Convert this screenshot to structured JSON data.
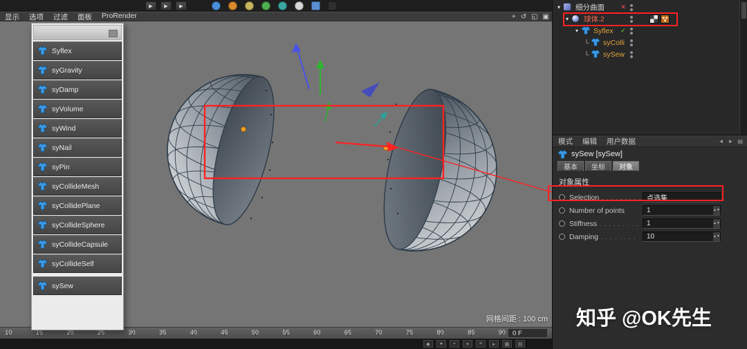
{
  "window": {
    "watermark": "知乎 @OK先生"
  },
  "top_toolbar": {
    "play_buttons": [
      "▶",
      "▶",
      "▶"
    ],
    "tool_icons": [
      {
        "name": "move-tool-icon",
        "color": "#4a90d9",
        "shape": "circle"
      },
      {
        "name": "rotate-tool-icon",
        "color": "#d98a2b",
        "shape": "circle"
      },
      {
        "name": "scale-tool-icon",
        "color": "#c8b560",
        "shape": "circle"
      },
      {
        "name": "axis-tool-icon",
        "color": "#4fae4f",
        "shape": "circle"
      },
      {
        "name": "coord-tool-icon",
        "color": "#3aa8a0",
        "shape": "circle"
      },
      {
        "name": "pen-tool-icon",
        "color": "#d8d8d8",
        "shape": "circle"
      },
      {
        "name": "grid-tool-icon",
        "color": "#5a8fd4",
        "shape": "square"
      },
      {
        "name": "render-tool-icon",
        "color": "#2f2f2f",
        "shape": "square"
      }
    ]
  },
  "viewport_menu": {
    "items": [
      "显示",
      "选项",
      "过滤",
      "面板",
      "ProRender"
    ],
    "view_icons": [
      {
        "name": "pan-view-icon",
        "glyph": "+"
      },
      {
        "name": "rotate-view-icon",
        "glyph": "↺"
      },
      {
        "name": "zoom-view-icon",
        "glyph": "◱"
      },
      {
        "name": "maximize-view-icon",
        "glyph": "▣"
      }
    ]
  },
  "tag_menu": {
    "items": [
      "Syflex",
      "syGravity",
      "syDamp",
      "syVolume",
      "syWind",
      "syNail",
      "syPin",
      "syCollideMesh",
      "syCollidePlane",
      "syCollideSphere",
      "syCollideCapsule",
      "syCollideSelf",
      "sySew"
    ]
  },
  "viewport": {
    "grid_label": "网格间距 : 100 cm"
  },
  "object_manager": {
    "rows": [
      {
        "label": "细分曲面",
        "label_color": "#d6d6d6",
        "depth": 0,
        "expander": true,
        "icon": "subdiv",
        "status_icon": "✕",
        "status_color": "#ff4d4d"
      },
      {
        "label": "球体.2",
        "label_color": "#ff6a52",
        "depth": 1,
        "expander": true,
        "icon": "sphere",
        "tags": true
      },
      {
        "label": "Syflex",
        "label_color": "#e3a33c",
        "depth": 2,
        "expander": true,
        "icon": "shirt",
        "status_icon": "✓",
        "status_color": "#74d63c"
      },
      {
        "label": "syColli",
        "label_color": "#e3a33c",
        "depth": 3,
        "expander": false,
        "icon": "shirt"
      },
      {
        "label": "sySew",
        "label_color": "#e3a33c",
        "depth": 3,
        "expander": false,
        "icon": "shirt"
      }
    ]
  },
  "attributes": {
    "menu_items": [
      "模式",
      "编辑",
      "用户数据"
    ],
    "menu_icons": [
      {
        "name": "back-icon",
        "glyph": "◄"
      },
      {
        "name": "forward-icon",
        "glyph": "►"
      },
      {
        "name": "panel-menu-icon",
        "glyph": "▤"
      }
    ],
    "object_title": "sySew [sySew]",
    "tabs": [
      {
        "label": "基本",
        "active": false
      },
      {
        "label": "坐标",
        "active": false
      },
      {
        "label": "对象",
        "active": true
      }
    ],
    "section_title": "对象属性",
    "rows": [
      {
        "label": "Selection",
        "leader": ". . . . . . . . .",
        "value": "点选集",
        "spinner": false
      },
      {
        "label": "Number of points",
        "leader": "",
        "value": "1",
        "spinner": true
      },
      {
        "label": "Stiffness",
        "leader": ". . . . . . . . .",
        "value": "1",
        "spinner": true
      },
      {
        "label": "Damping",
        "leader": ". . . . . . . .",
        "value": "10",
        "spinner": true
      }
    ]
  },
  "timeline": {
    "ticks": [
      "10",
      "15",
      "20",
      "25",
      "30",
      "35",
      "40",
      "45",
      "50",
      "55",
      "60",
      "65",
      "70",
      "75",
      "80",
      "85",
      "90"
    ],
    "frame_field": "0 F"
  },
  "bottom_toolbar": {
    "icons": [
      {
        "name": "timeline-key-icon",
        "glyph": "◆"
      },
      {
        "name": "timeline-record-icon",
        "glyph": "●"
      },
      {
        "name": "timeline-keyframe-icon",
        "glyph": "▪"
      },
      {
        "name": "timeline-marker-icon",
        "glyph": "▾"
      },
      {
        "name": "timeline-track-icon",
        "glyph": "≡"
      },
      {
        "name": "timeline-options-icon",
        "glyph": "▸"
      },
      {
        "name": "snap-icon",
        "glyph": "▦"
      },
      {
        "name": "grid-toggle-icon",
        "glyph": "▤"
      }
    ]
  },
  "annotations": {
    "highlight_color": "#ff2222",
    "selected_point_color": "#ffa024"
  }
}
